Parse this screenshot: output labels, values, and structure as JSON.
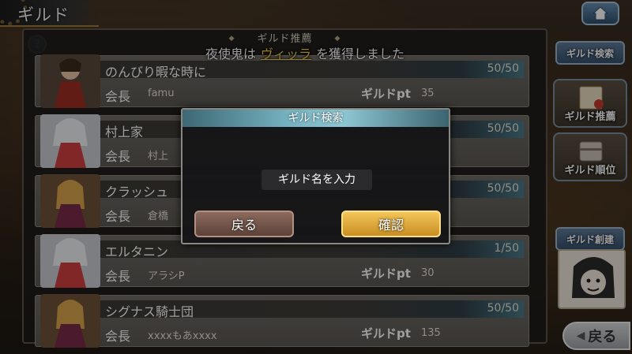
{
  "header": {
    "title": "ギルド"
  },
  "panel": {
    "title": "ギルド推薦"
  },
  "banner": {
    "prefix": "夜使鬼は",
    "highlight": "ヴィッラ",
    "suffix": "を獲得しました"
  },
  "help": {
    "label": "?"
  },
  "guilds": [
    {
      "name": "のんびり暇な時に",
      "count": "50/50",
      "leader_label": "会長",
      "leader": "famu",
      "pt_label": "ギルドpt",
      "pt": "35"
    },
    {
      "name": "村上家",
      "count": "50/50",
      "leader_label": "会長",
      "leader": "村上",
      "pt_label": "",
      "pt": ""
    },
    {
      "name": "クラッシュ",
      "count": "50/50",
      "leader_label": "会長",
      "leader": "倉橋",
      "pt_label": "",
      "pt": ""
    },
    {
      "name": "エルタニン",
      "count": "1/50",
      "leader_label": "会長",
      "leader": "アラシP",
      "pt_label": "ギルドpt",
      "pt": "30"
    },
    {
      "name": "シグナス騎士団",
      "count": "50/50",
      "leader_label": "会長",
      "leader": "xxxxもあxxxx",
      "pt_label": "ギルドpt",
      "pt": "135"
    }
  ],
  "side": {
    "search": "ギルド検索",
    "recommend": "ギルド推薦",
    "ranking": "ギルド順位",
    "create": "ギルド創建",
    "back": "戻る"
  },
  "dialog": {
    "title": "ギルド検索",
    "placeholder": "ギルド名を入力",
    "back": "戻る",
    "confirm": "確認"
  }
}
